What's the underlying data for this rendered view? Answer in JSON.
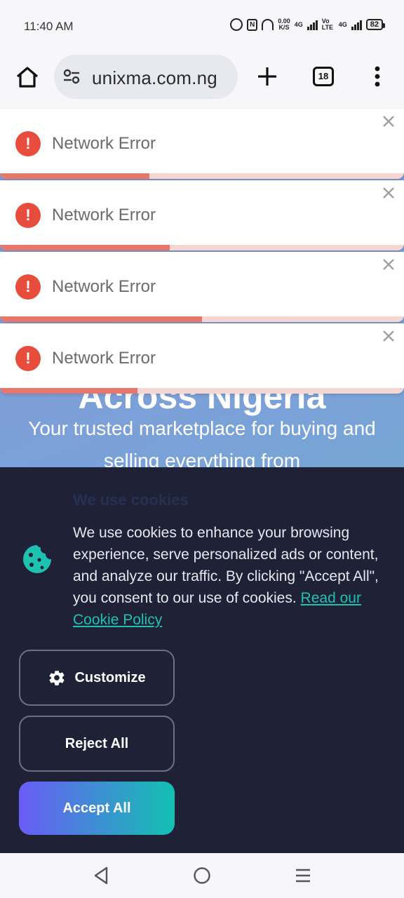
{
  "status_bar": {
    "time": "11:40 AM",
    "speed_value": "0.00",
    "speed_unit": "K/S",
    "sim1_label": "4G",
    "volte_label": "Vo LTE",
    "sim2_label": "4G",
    "battery": "82"
  },
  "browser": {
    "url": "unixma.com.ng",
    "tab_count": "18"
  },
  "hero": {
    "heading": "Across Nigeria",
    "subtitle": "Your trusted marketplace for buying and selling everything from"
  },
  "toasts": [
    {
      "message": "Network Error",
      "progress": 0.37
    },
    {
      "message": "Network Error",
      "progress": 0.42
    },
    {
      "message": "Network Error",
      "progress": 0.5
    },
    {
      "message": "Network Error",
      "progress": 0.34
    }
  ],
  "cookie_banner": {
    "heading": "We use cookies",
    "body": "We use cookies to enhance your browsing experience, serve personalized ads or content, and analyze our traffic. By clicking \"Accept All\", you consent to our use of cookies.",
    "link_text": "Read our Cookie Policy",
    "customize_label": "Customize",
    "reject_label": "Reject All",
    "accept_label": "Accept All"
  },
  "colors": {
    "error_red": "#e74c3c",
    "banner_bg": "#1f2237",
    "accent_teal": "#1fc2b0",
    "accent_purple": "#6a5cf5"
  },
  "icons": {
    "home": "home-icon",
    "site_settings": "tune-icon",
    "new_tab": "plus-icon",
    "menu": "more-vert-icon",
    "toast_error": "error-icon",
    "toast_close": "close-icon",
    "cookie": "cookie-icon",
    "customize": "gear-icon",
    "nav_back": "back-icon",
    "nav_home": "circle-home-icon",
    "nav_recent": "recents-icon"
  }
}
